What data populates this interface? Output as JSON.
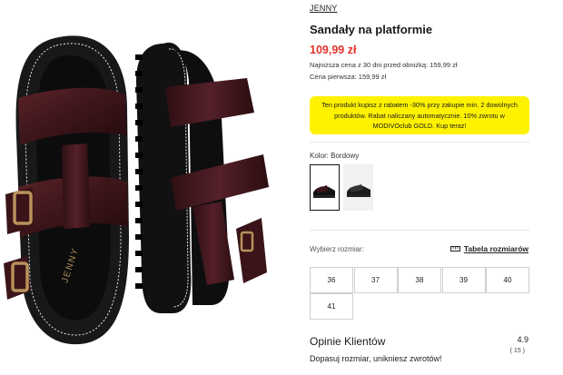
{
  "product": {
    "brand": "JENNY",
    "name": "Sandały na platformie",
    "price": "109,99 zł",
    "lowest_price_text": "Najniższa cena z 30 dni przed obniżką: 159,99 zł",
    "first_price_text": "Cena pierwsza: 159,99 zł",
    "insole_logo": "JENNY"
  },
  "promo": {
    "text": "Ten produkt kupisz z rabatem -30% przy zakupie min. 2 dowolnych produktów. Rabat naliczany automatycznie. 10% zwrotu w MODIVOclub GOLD. Kup teraz!",
    "background": "#fff200"
  },
  "color": {
    "label": "Kolor: Bordowy",
    "swatches": [
      "Bordowy",
      "alternate"
    ]
  },
  "size": {
    "label": "Wybierz rozmiar:",
    "chart_link": "Tabela rozmiarów",
    "chart_icon": "ruler-icon",
    "options": [
      "36",
      "37",
      "38",
      "39",
      "40",
      "41"
    ]
  },
  "reviews": {
    "title": "Opinie Klientów",
    "rating": "4.9",
    "count": "( 15 )",
    "subtitle": "Dopasuj rozmiar, unikniesz zwrotów!"
  },
  "colors": {
    "price": "#e2332b",
    "leather": "#3b1519",
    "sole": "#111111"
  }
}
